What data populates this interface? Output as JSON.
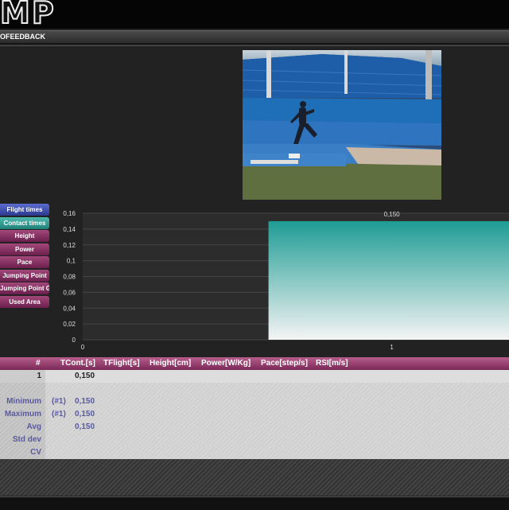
{
  "app": {
    "logo_text": "MP",
    "section_title": "OFEEDBACK"
  },
  "tabs": [
    {
      "label": "Flight times",
      "active": false
    },
    {
      "label": "Contact times",
      "active": true
    },
    {
      "label": "Height",
      "active": false
    },
    {
      "label": "Power",
      "active": false
    },
    {
      "label": "Pace",
      "active": false
    },
    {
      "label": "Jumping Point",
      "active": false
    },
    {
      "label": "Jumping Point Gap",
      "active": false
    },
    {
      "label": "Used Area",
      "active": false
    }
  ],
  "chart_data": {
    "type": "bar",
    "x": [
      1
    ],
    "values": [
      0.15
    ],
    "data_labels": [
      "0,150"
    ],
    "ylim": [
      0,
      0.16
    ],
    "yticks": [
      "0,16",
      "0,14",
      "0,12",
      "0,1",
      "0,08",
      "0,06",
      "0,04",
      "0,02",
      "0"
    ],
    "xticks": [
      "0",
      "1"
    ],
    "grid": true,
    "colors": {
      "bar_top": "#1f9c94",
      "bar_bottom": "#f4f4f4"
    }
  },
  "table": {
    "headers": [
      "#",
      "TCont.[s]",
      "TFlight[s]",
      "Height[cm]",
      "Power[W/Kg]",
      "Pace[step/s]",
      "RSI[m/s]"
    ],
    "rows": [
      {
        "label": "1",
        "ref": "",
        "value": "0,150"
      },
      {
        "label": "",
        "ref": "",
        "value": ""
      },
      {
        "label": "Minimum",
        "ref": "(#1)",
        "value": "0,150"
      },
      {
        "label": "Maximum",
        "ref": "(#1)",
        "value": "0,150"
      },
      {
        "label": "Avg",
        "ref": "",
        "value": "0,150"
      },
      {
        "label": "Std dev",
        "ref": "",
        "value": ""
      },
      {
        "label": "CV",
        "ref": "",
        "value": ""
      }
    ]
  }
}
